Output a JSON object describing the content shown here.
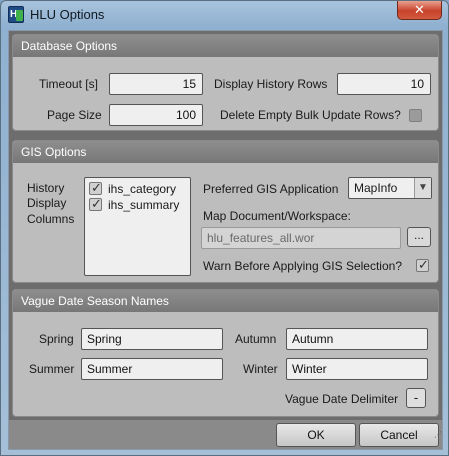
{
  "window": {
    "title": "HLU Options",
    "close_glyph": "✕",
    "app_icon_letter": "H"
  },
  "database": {
    "header": "Database Options",
    "timeout_label": "Timeout [s]",
    "timeout_value": "15",
    "display_history_label": "Display History Rows",
    "display_history_value": "10",
    "page_size_label": "Page Size",
    "page_size_value": "100",
    "delete_empty_label": "Delete Empty Bulk Update Rows?",
    "delete_empty_checked": false
  },
  "gis": {
    "header": "GIS Options",
    "history_label_1": "History",
    "history_label_2": "Display",
    "history_label_3": "Columns",
    "history_columns": [
      {
        "label": "ihs_category",
        "checked": true
      },
      {
        "label": "ihs_summary",
        "checked": true
      }
    ],
    "preferred_app_label": "Preferred GIS Application",
    "preferred_app_value": "MapInfo",
    "map_doc_label": "Map Document/Workspace:",
    "map_doc_value": "hlu_features_all.wor",
    "browse_label": "...",
    "warn_label": "Warn Before Applying GIS Selection?",
    "warn_checked": true
  },
  "vague_date": {
    "header": "Vague Date Season Names",
    "spring_label": "Spring",
    "spring_value": "Spring",
    "autumn_label": "Autumn",
    "autumn_value": "Autumn",
    "summer_label": "Summer",
    "summer_value": "Summer",
    "winter_label": "Winter",
    "winter_value": "Winter",
    "delimiter_label": "Vague Date Delimiter",
    "delimiter_value": "-"
  },
  "buttons": {
    "ok": "OK",
    "cancel": "Cancel"
  },
  "glyphs": {
    "tick": "✓",
    "dropdown": "▼",
    "grip": "⋰"
  },
  "colors": {
    "close_red": "#c7432b",
    "group_header": "#808080",
    "title_bar": "#a9c3dc"
  }
}
